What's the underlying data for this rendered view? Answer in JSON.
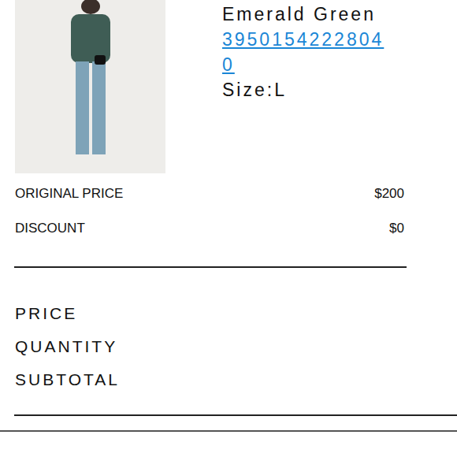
{
  "product": {
    "color_name": "Emerald Green",
    "sku": "39501542228040",
    "size": "Size:L"
  },
  "summary": [
    {
      "label": "ORIGINAL PRICE",
      "value": "$200"
    },
    {
      "label": "DISCOUNT",
      "value": "$0"
    }
  ],
  "totals": [
    "PRICE",
    "QUANTITY",
    "SUBTOTAL"
  ]
}
